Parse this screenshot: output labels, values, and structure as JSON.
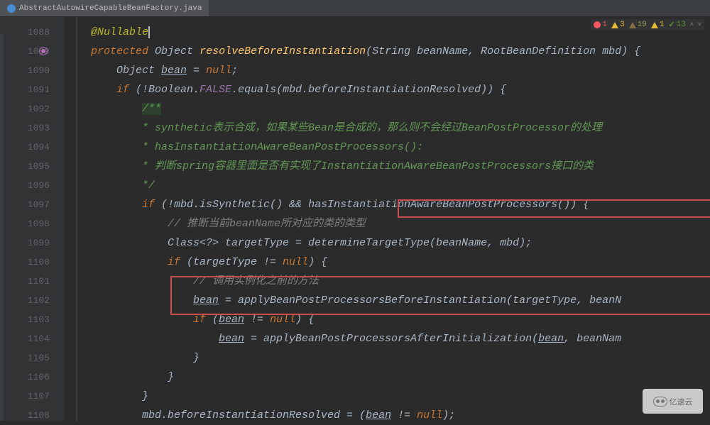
{
  "tab": {
    "filename": "AbstractAutowireCapableBeanFactory.java"
  },
  "status": {
    "errors": "1",
    "warnings": "3",
    "weak_warnings": "19",
    "pass": "1",
    "green": "13"
  },
  "lines": {
    "start": 1088,
    "l1088": "@Nullable",
    "l1089_kw1": "protected",
    "l1089_type": "Object",
    "l1089_method": "resolveBeforeInstantiation",
    "l1089_params": "(String beanName, RootBeanDefinition mbd)",
    "l1090_type": "Object",
    "l1090_var": "bean",
    "l1090_rest": " = ",
    "l1090_null": "null",
    "l1091_if": "if",
    "l1091_cond_a": " (!Boolean.",
    "l1091_false": "FALSE",
    "l1091_cond_b": ".equals(mbd.beforeInstantiationResolved)) {",
    "l1092": "/**",
    "l1093": " * synthetic表示合成，如果某些Bean是合成的，那么则不会经过BeanPostProcessor的处理",
    "l1094": " * hasInstantiationAwareBeanPostProcessors():",
    "l1095": " * 判断spring容器里面是否有实现了InstantiationAwareBeanPostProcessors接口的类",
    "l1096": " */",
    "l1097_if": "if",
    "l1097_a": " (!mbd.isSynthetic() && ",
    "l1097_b": "hasInstantiationAwareBeanPostProcessors()",
    "l1097_c": ") {",
    "l1098": "// 推断当前beanName所对应的类的类型",
    "l1099": "Class<?> targetType = determineTargetType(beanName, mbd);",
    "l1100_if": "if",
    "l1100_rest": " (targetType != ",
    "l1100_null": "null",
    "l1100_end": ") {",
    "l1101": "//  调用实例化之前的方法",
    "l1102_var": "bean",
    "l1102_rest": " = applyBeanPostProcessorsBeforeInstantiation(targetType, beanN",
    "l1103_if": "if",
    "l1103_a": " (",
    "l1103_var": "bean",
    "l1103_b": " != ",
    "l1103_null": "null",
    "l1103_c": ") {",
    "l1104_var": "bean",
    "l1104_rest": " = applyBeanPostProcessorsAfterInitialization(",
    "l1104_var2": "bean",
    "l1104_end": ", beanNam",
    "l1105": "}",
    "l1106": "}",
    "l1107": "}",
    "l1108_a": "mbd.beforeInstantiationResolved = (",
    "l1108_var": "bean",
    "l1108_b": " != ",
    "l1108_null": "null",
    "l1108_c": ");"
  },
  "watermark": "亿速云"
}
